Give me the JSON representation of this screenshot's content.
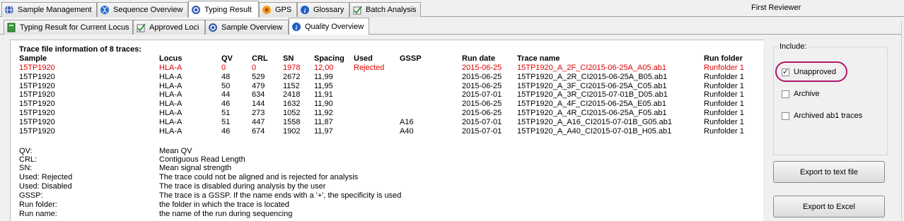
{
  "reviewer": "First Reviewer",
  "main_tabs": [
    {
      "label": "Sample Management",
      "icon": "globe-icon"
    },
    {
      "label": "Sequence Overview",
      "icon": "dna-icon"
    },
    {
      "label": "Typing Result",
      "icon": "dna-ring-icon"
    },
    {
      "label": "GPS",
      "icon": "gps-icon"
    },
    {
      "label": "Glossary",
      "icon": "info-icon"
    },
    {
      "label": "Batch Analysis",
      "icon": "checklist-icon"
    }
  ],
  "sub_tabs": [
    {
      "label": "Typing Result for Current Locus",
      "icon": "book-icon"
    },
    {
      "label": "Approved Loci",
      "icon": "checklist-icon"
    },
    {
      "label": "Sample Overview",
      "icon": "dna-ring-icon"
    },
    {
      "label": "Quality Overview",
      "icon": "info-icon"
    }
  ],
  "table": {
    "heading": "Trace file information of 8 traces:",
    "columns": [
      "Sample",
      "Locus",
      "QV",
      "CRL",
      "SN",
      "Spacing",
      "Used",
      "GSSP",
      "Run date",
      "Trace name",
      "Run folder"
    ],
    "rows": [
      {
        "flag": "red",
        "cells": [
          "15TP1920",
          "HLA-A",
          "0",
          "0",
          "1978",
          "12,00",
          "Rejected",
          "",
          "2015-06-25",
          "15TP1920_A_2F_CI2015-06-25A_A05.ab1",
          "Runfolder 1"
        ]
      },
      {
        "flag": "",
        "cells": [
          "15TP1920",
          "HLA-A",
          "48",
          "529",
          "2672",
          "11,99",
          "",
          "",
          "2015-06-25",
          "15TP1920_A_2R_CI2015-06-25A_B05.ab1",
          "Runfolder 1"
        ]
      },
      {
        "flag": "",
        "cells": [
          "15TP1920",
          "HLA-A",
          "50",
          "479",
          "1152",
          "11,95",
          "",
          "",
          "2015-06-25",
          "15TP1920_A_3F_CI2015-06-25A_C05.ab1",
          "Runfolder 1"
        ]
      },
      {
        "flag": "",
        "cells": [
          "15TP1920",
          "HLA-A",
          "44",
          "634",
          "2418",
          "11,91",
          "",
          "",
          "2015-07-01",
          "15TP1920_A_3R_CI2015-07-01B_D05.ab1",
          "Runfolder 1"
        ]
      },
      {
        "flag": "",
        "cells": [
          "15TP1920",
          "HLA-A",
          "46",
          "144",
          "1632",
          "11,90",
          "",
          "",
          "2015-06-25",
          "15TP1920_A_4F_CI2015-06-25A_E05.ab1",
          "Runfolder 1"
        ]
      },
      {
        "flag": "",
        "cells": [
          "15TP1920",
          "HLA-A",
          "51",
          "273",
          "1052",
          "11,92",
          "",
          "",
          "2015-06-25",
          "15TP1920_A_4R_CI2015-06-25A_F05.ab1",
          "Runfolder 1"
        ]
      },
      {
        "flag": "",
        "cells": [
          "15TP1920",
          "HLA-A",
          "51",
          "447",
          "1558",
          "11,87",
          "",
          "A16",
          "2015-07-01",
          "15TP1920_A_A16_CI2015-07-01B_G05.ab1",
          "Runfolder 1"
        ]
      },
      {
        "flag": "",
        "cells": [
          "15TP1920",
          "HLA-A",
          "46",
          "674",
          "1902",
          "11,97",
          "",
          "A40",
          "2015-07-01",
          "15TP1920_A_A40_CI2015-07-01B_H05.ab1",
          "Runfolder 1"
        ]
      }
    ]
  },
  "legend": [
    {
      "key": "QV:",
      "value": "Mean QV"
    },
    {
      "key": "CRL:",
      "value": "Contiguous Read Length"
    },
    {
      "key": "SN:",
      "value": "Mean signal strength"
    },
    {
      "key": "Used: Rejected",
      "value": "The trace could not be aligned and is rejected for analysis"
    },
    {
      "key": "Used: Disabled",
      "value": "The trace is disabled during analysis by the user"
    },
    {
      "key": "GSSP:",
      "value": "The trace is a GSSP. If the name ends with a '+', the specificity is used"
    },
    {
      "key": "Run folder:",
      "value": "the folder in which the trace is located"
    },
    {
      "key": "Run name:",
      "value": "the name of the run during sequencing"
    }
  ],
  "include": {
    "label": "Include:",
    "options": [
      {
        "label": "Unapproved",
        "checked": true
      },
      {
        "label": "Archive",
        "checked": false
      },
      {
        "label": "Archived ab1 traces",
        "checked": false
      }
    ]
  },
  "buttons": {
    "export_text": "Export to text file",
    "export_excel": "Export to Excel"
  },
  "colors": {
    "rejected": "#e00000",
    "highlight": "#b0186e"
  }
}
